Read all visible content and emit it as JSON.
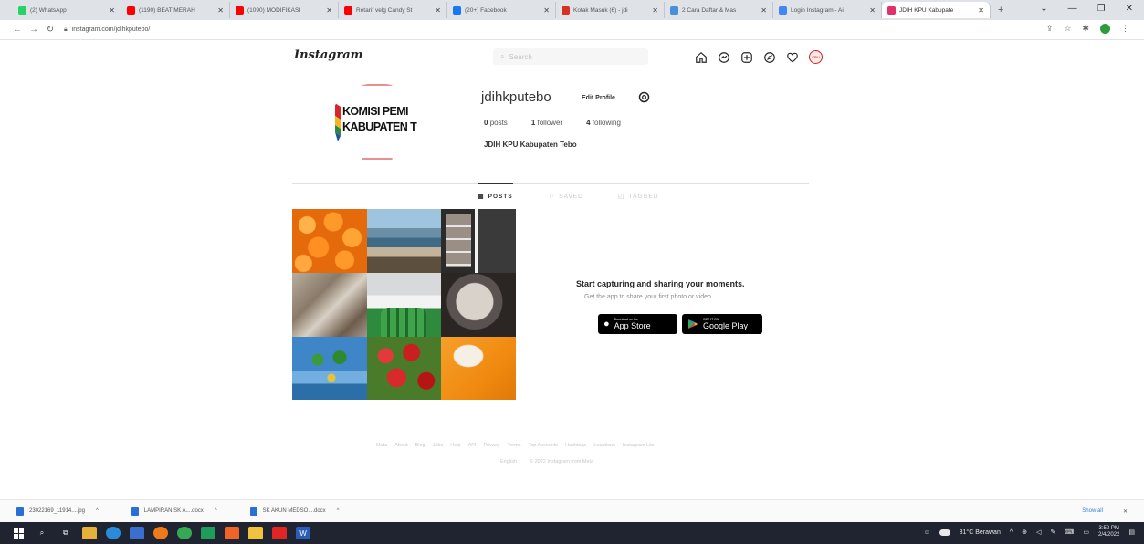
{
  "browser": {
    "tabs": [
      {
        "label": "(2) WhatsApp",
        "favicon_color": "#25d366",
        "active": false
      },
      {
        "label": "(1190) BEAT MERAH",
        "favicon_color": "#ff0000",
        "active": false
      },
      {
        "label": "(1090) MODIFIKASI",
        "favicon_color": "#ff0000",
        "active": false
      },
      {
        "label": "Retarif velg Candy St",
        "favicon_color": "#ff0000",
        "active": false
      },
      {
        "label": "(20+) Facebook",
        "favicon_color": "#1877f2",
        "active": false
      },
      {
        "label": "Kotak Masuk (6) - jdi",
        "favicon_color": "#d93025",
        "active": false
      },
      {
        "label": "2 Cara Daftar & Mas",
        "favicon_color": "#4a90d9",
        "active": false
      },
      {
        "label": "Login Instagram - Ai",
        "favicon_color": "#4285f4",
        "active": false
      },
      {
        "label": "JDIH KPU Kabupate",
        "favicon_color": "#e1306c",
        "active": true
      }
    ],
    "new_tab": "+",
    "window_controls": [
      "⌄",
      "—",
      "❐",
      "✕"
    ],
    "url": "instagram.com/jdihkputebo/"
  },
  "header": {
    "logo": "Instagram",
    "search_placeholder": "Search"
  },
  "profile": {
    "picture_line1": "KOMISI PEMI",
    "picture_line2": "KABUPATEN T",
    "username": "jdihkputebo",
    "edit_button": "Edit Profile",
    "posts_count": "0",
    "posts_label": "posts",
    "followers_count": "1",
    "followers_label": "follower",
    "following_count": "4",
    "following_label": "following",
    "full_name": "JDIH KPU Kabupaten Tebo"
  },
  "tabs": {
    "posts": "POSTS",
    "saved": "SAVED",
    "tagged": "TAGGED"
  },
  "empty_state": {
    "title": "Start capturing and sharing your moments.",
    "subtitle": "Get the app to share your first photo or video.",
    "app_store_small": "Download on the",
    "app_store_large": "App Store",
    "google_play_small": "GET IT ON",
    "google_play_large": "Google Play"
  },
  "footer": {
    "links": [
      "Meta",
      "About",
      "Blog",
      "Jobs",
      "Help",
      "API",
      "Privacy",
      "Terms",
      "Top Accounts",
      "Hashtags",
      "Locations",
      "Instagram Lite"
    ],
    "language": "English",
    "copyright": "© 2022 Instagram from Meta"
  },
  "downloads": {
    "items": [
      {
        "label": "23022169_11914....jpg",
        "color": "#2a6fd6"
      },
      {
        "label": "LAMPIRAN SK A....docx",
        "color": "#2a6fd6"
      },
      {
        "label": "SK AKUN MEDSO....docx",
        "color": "#2a6fd6"
      }
    ],
    "show_all": "Show all",
    "close": "✕"
  },
  "taskbar": {
    "weather": "31°C Berawan",
    "time": "3:52 PM",
    "date": "2/4/2022",
    "colors": {
      "bg": "#1f2430"
    }
  }
}
